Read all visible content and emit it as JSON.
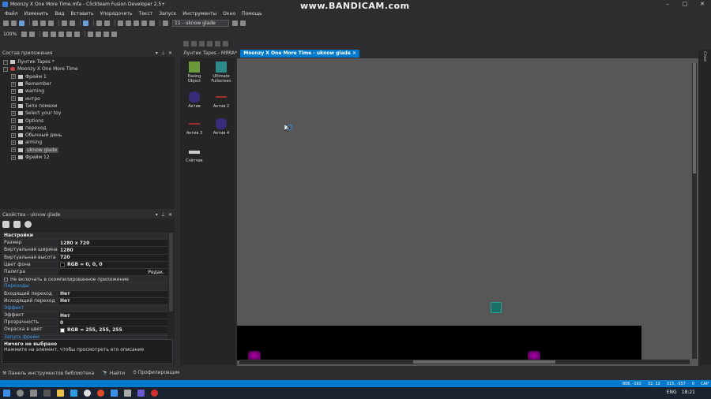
{
  "window": {
    "title": "Moonzy X One More Time.mfa - Clickteam Fusion Developer 2.5+",
    "watermark": "www.BANDICAM.com",
    "controls": [
      "–",
      "□",
      "✕"
    ]
  },
  "menu": [
    "Файл",
    "Изменить",
    "Вид",
    "Вставить",
    "Упорядочить",
    "Текст",
    "Запуск",
    "Инструменты",
    "Окно",
    "Помощь"
  ],
  "toolbar": {
    "frame_select": "11 - uknow glade",
    "zoom": "100%"
  },
  "app_panel": {
    "title": "Состав приложения",
    "items": [
      {
        "label": "Лунтик Tapes *",
        "level": 0
      },
      {
        "label": "Moonzy X One More Time",
        "level": 0
      },
      {
        "label": "Фрейм 1",
        "level": 1
      },
      {
        "label": "Remember",
        "level": 1
      },
      {
        "label": "warning",
        "level": 1
      },
      {
        "label": "интро",
        "level": 1
      },
      {
        "label": "Типо помехи",
        "level": 1
      },
      {
        "label": "Select your toy",
        "level": 1
      },
      {
        "label": "Options",
        "level": 1
      },
      {
        "label": "переход",
        "level": 1
      },
      {
        "label": "Обычный день",
        "level": 1
      },
      {
        "label": "arming",
        "level": 1
      },
      {
        "label": "uknow glade",
        "level": 1,
        "selected": true
      },
      {
        "label": "Фрейм 12",
        "level": 1
      }
    ]
  },
  "props_panel": {
    "title": "Свойства - uknow glade",
    "section": "Настройки",
    "rows": [
      {
        "k": "Размер",
        "v": "1280 x 720"
      },
      {
        "k": "Виртуальная ширина",
        "v": "1280"
      },
      {
        "k": "Виртуальная высота",
        "v": "720"
      },
      {
        "k": "Цвет фона",
        "v": "RGB = 0, 0, 0",
        "swatch": "#000000"
      },
      {
        "k": "Палитра",
        "v": "Редак."
      }
    ],
    "checkbox": "Не включать в скомпилированное приложение",
    "link1": "Переходы",
    "rows2": [
      {
        "k": "Входящий переход",
        "v": "Нет"
      },
      {
        "k": "Исходящий переход",
        "v": "Нет"
      }
    ],
    "link2": "Эффект",
    "rows3": [
      {
        "k": "Эффект",
        "v": "Нет"
      },
      {
        "k": "Прозрачность",
        "v": "0"
      },
      {
        "k": "Окраска в цвет",
        "v": "RGB = 255, 255, 255",
        "swatch": "#ffffff"
      }
    ],
    "link3": "Запуск фрейм"
  },
  "description": {
    "title": "Ничего не выбрано",
    "text": "Нажмите на элемент, чтобы просмотреть его описание"
  },
  "bottom_tabs": [
    "Панель инструментов библиотека",
    "Найти",
    "Профилировщик"
  ],
  "editor_tabs": [
    {
      "label": "Лунтик Tapes - МЯRA*",
      "active": false
    },
    {
      "label": "Moonzy X One More Time - uknow glade",
      "active": true
    }
  ],
  "objects": [
    {
      "label": "Easing Object"
    },
    {
      "label": "Ultimate Fullscreen"
    },
    {
      "label": "Актив"
    },
    {
      "label": "Актив 2"
    },
    {
      "label": "Актив 3"
    },
    {
      "label": "Актив 4"
    },
    {
      "label": "Счётчик"
    }
  ],
  "right_strip": [
    "Слои"
  ],
  "status": {
    "coords1": "808, -192",
    "coords2": "32, 32",
    "coords3": "315, -557",
    "value": "0",
    "caps": "CAP"
  },
  "taskbar": {
    "lang": "ENG",
    "time": "18:21"
  },
  "colors": {
    "accent": "#007acc",
    "canvas": "#575757"
  }
}
